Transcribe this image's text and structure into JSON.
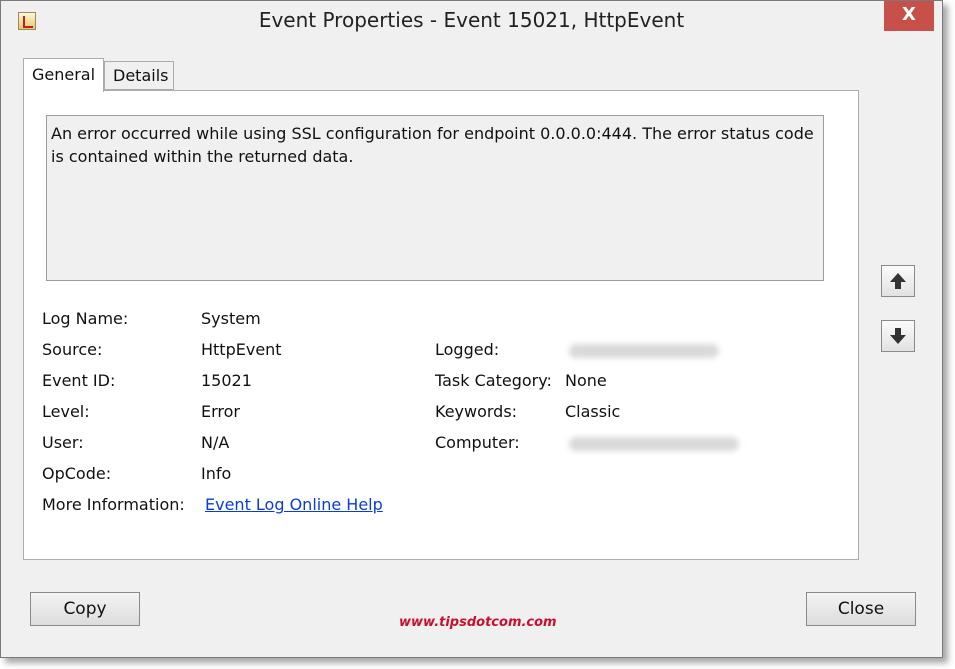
{
  "window": {
    "title": "Event Properties - Event 15021, HttpEvent",
    "close_label": "X"
  },
  "tabs": [
    {
      "label": "General",
      "active": true
    },
    {
      "label": "Details",
      "active": false
    }
  ],
  "description": "An error occurred while using SSL configuration for endpoint 0.0.0.0:444.  The error status code is contained within the returned data.",
  "fields_left": {
    "log_name": {
      "label": "Log Name:",
      "value": "System"
    },
    "source": {
      "label": "Source:",
      "value": "HttpEvent"
    },
    "event_id": {
      "label": "Event ID:",
      "value": "15021"
    },
    "level": {
      "label": "Level:",
      "value": "Error"
    },
    "user": {
      "label": "User:",
      "value": "N/A"
    },
    "opcode": {
      "label": "OpCode:",
      "value": "Info"
    },
    "more_info": {
      "label": "More Information:",
      "link": "Event Log Online Help"
    }
  },
  "fields_right": {
    "logged": {
      "label": "Logged:"
    },
    "task_category": {
      "label": "Task Category:",
      "value": "None"
    },
    "keywords": {
      "label": "Keywords:",
      "value": "Classic"
    },
    "computer": {
      "label": "Computer:"
    }
  },
  "nav": {
    "up_icon": "arrow-up-icon",
    "down_icon": "arrow-down-icon"
  },
  "buttons": {
    "copy": "Copy",
    "close": "Close"
  },
  "watermark": "www.tipsdotcom.com"
}
